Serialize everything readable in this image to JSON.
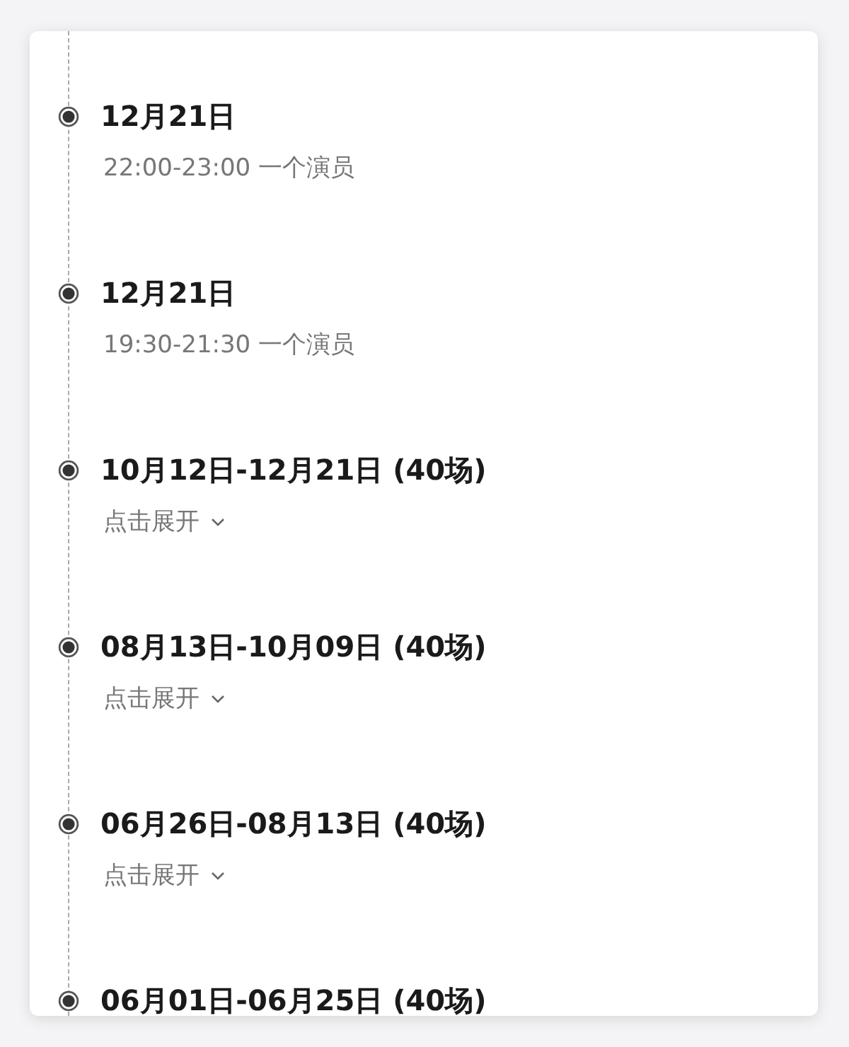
{
  "timeline": {
    "items": [
      {
        "kind": "detail",
        "title": "12月21日",
        "subtitle": "22:00-23:00 一个演员"
      },
      {
        "kind": "detail",
        "title": "12月21日",
        "subtitle": "19:30-21:30 一个演员"
      },
      {
        "kind": "expand",
        "title": "10月12日-12月21日 (40场)",
        "expand_label": "点击展开"
      },
      {
        "kind": "expand",
        "title": "08月13日-10月09日 (40场)",
        "expand_label": "点击展开"
      },
      {
        "kind": "expand",
        "title": "06月26日-08月13日 (40场)",
        "expand_label": "点击展开"
      },
      {
        "kind": "plain",
        "title": "06月01日-06月25日 (40场)"
      }
    ]
  }
}
